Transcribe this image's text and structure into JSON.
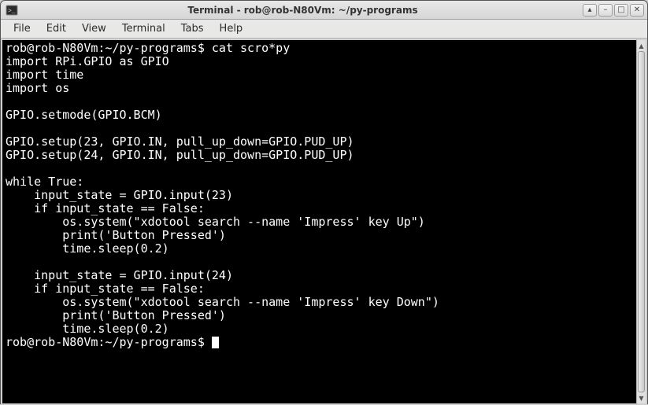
{
  "window": {
    "title": "Terminal - rob@rob-N80Vm: ~/py-programs"
  },
  "menubar": {
    "items": [
      "File",
      "Edit",
      "View",
      "Terminal",
      "Tabs",
      "Help"
    ]
  },
  "window_controls": {
    "stick": "▴",
    "minimize": "–",
    "maximize": "□",
    "close": "✕"
  },
  "terminal": {
    "prompt1": "rob@rob-N80Vm:~/py-programs$ ",
    "cmd1": "cat scro*py",
    "lines": [
      "import RPi.GPIO as GPIO",
      "import time",
      "import os",
      "",
      "GPIO.setmode(GPIO.BCM)",
      "",
      "GPIO.setup(23, GPIO.IN, pull_up_down=GPIO.PUD_UP)",
      "GPIO.setup(24, GPIO.IN, pull_up_down=GPIO.PUD_UP)",
      "",
      "while True:",
      "    input_state = GPIO.input(23)",
      "    if input_state == False:",
      "        os.system(\"xdotool search --name 'Impress' key Up\")",
      "        print('Button Pressed')",
      "        time.sleep(0.2)",
      "",
      "    input_state = GPIO.input(24)",
      "    if input_state == False:",
      "        os.system(\"xdotool search --name 'Impress' key Down\")",
      "        print('Button Pressed')",
      "        time.sleep(0.2)"
    ],
    "prompt2": "rob@rob-N80Vm:~/py-programs$ "
  }
}
